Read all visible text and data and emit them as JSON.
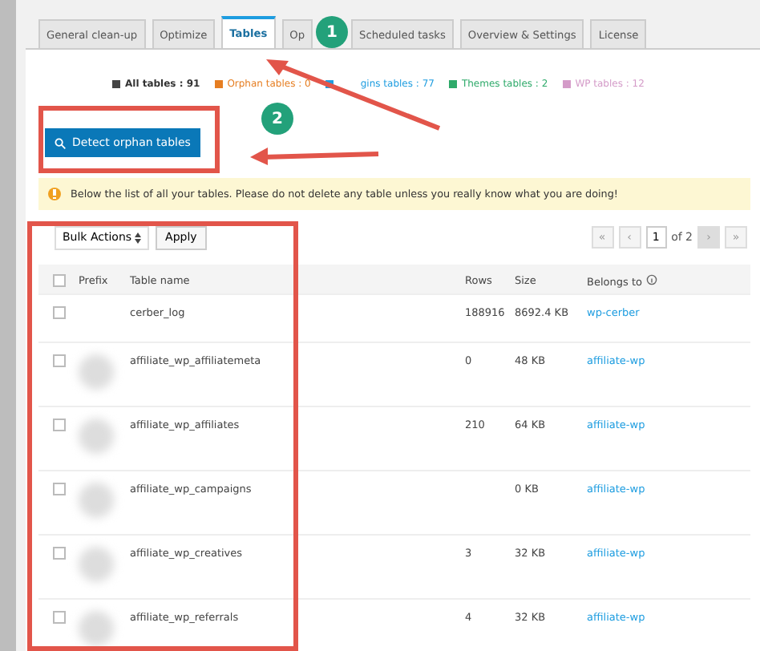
{
  "tabs": [
    {
      "label": "General clean-up",
      "selected": false
    },
    {
      "label": "Optimize",
      "selected": false
    },
    {
      "label": "Tables",
      "selected": true
    },
    {
      "label": "Op",
      "selected": false
    },
    {
      "label": "Scheduled tasks",
      "selected": false
    },
    {
      "label": "Overview & Settings",
      "selected": false
    },
    {
      "label": "License",
      "selected": false
    }
  ],
  "legend": [
    {
      "label": "All tables : 91",
      "color": "#444444"
    },
    {
      "label": "Orphan tables : 0",
      "color": "#e67e22"
    },
    {
      "label": "gins tables : 77",
      "color": "#1e9de0"
    },
    {
      "label": "Themes tables : 2",
      "color": "#2eaa6a"
    },
    {
      "label": "WP tables : 12",
      "color": "#d49bc8"
    }
  ],
  "detect_button": "Detect orphan tables",
  "notice": "Below the list of all your tables. Please do not delete any table unless you really know what you are doing!",
  "bulk_actions": "Bulk Actions",
  "apply_button": "Apply",
  "pagination": {
    "first": "«",
    "prev": "‹",
    "page": "1",
    "of": "of 2",
    "next": "›",
    "last": "»"
  },
  "select_all_checked": false,
  "columns": [
    "Prefix",
    "Table name",
    "Rows",
    "Size",
    "Belongs to"
  ],
  "rows": [
    {
      "checked": false,
      "prefix_hidden": false,
      "name": "cerber_log",
      "rows": "188916",
      "size": "8692.4 KB",
      "belongs": "wp-cerber"
    },
    {
      "checked": false,
      "prefix_hidden": true,
      "name": "affiliate_wp_affiliatemeta",
      "rows": "0",
      "size": "48 KB",
      "belongs": "affiliate-wp"
    },
    {
      "checked": false,
      "prefix_hidden": true,
      "name": "affiliate_wp_affiliates",
      "rows": "210",
      "size": "64 KB",
      "belongs": "affiliate-wp"
    },
    {
      "checked": false,
      "prefix_hidden": true,
      "name": "affiliate_wp_campaigns",
      "rows": "",
      "size": "0 KB",
      "belongs": "affiliate-wp"
    },
    {
      "checked": false,
      "prefix_hidden": true,
      "name": "affiliate_wp_creatives",
      "rows": "3",
      "size": "32 KB",
      "belongs": "affiliate-wp"
    },
    {
      "checked": false,
      "prefix_hidden": true,
      "name": "affiliate_wp_referrals",
      "rows": "4",
      "size": "32 KB",
      "belongs": "affiliate-wp"
    }
  ],
  "callouts": [
    "1",
    "2"
  ]
}
